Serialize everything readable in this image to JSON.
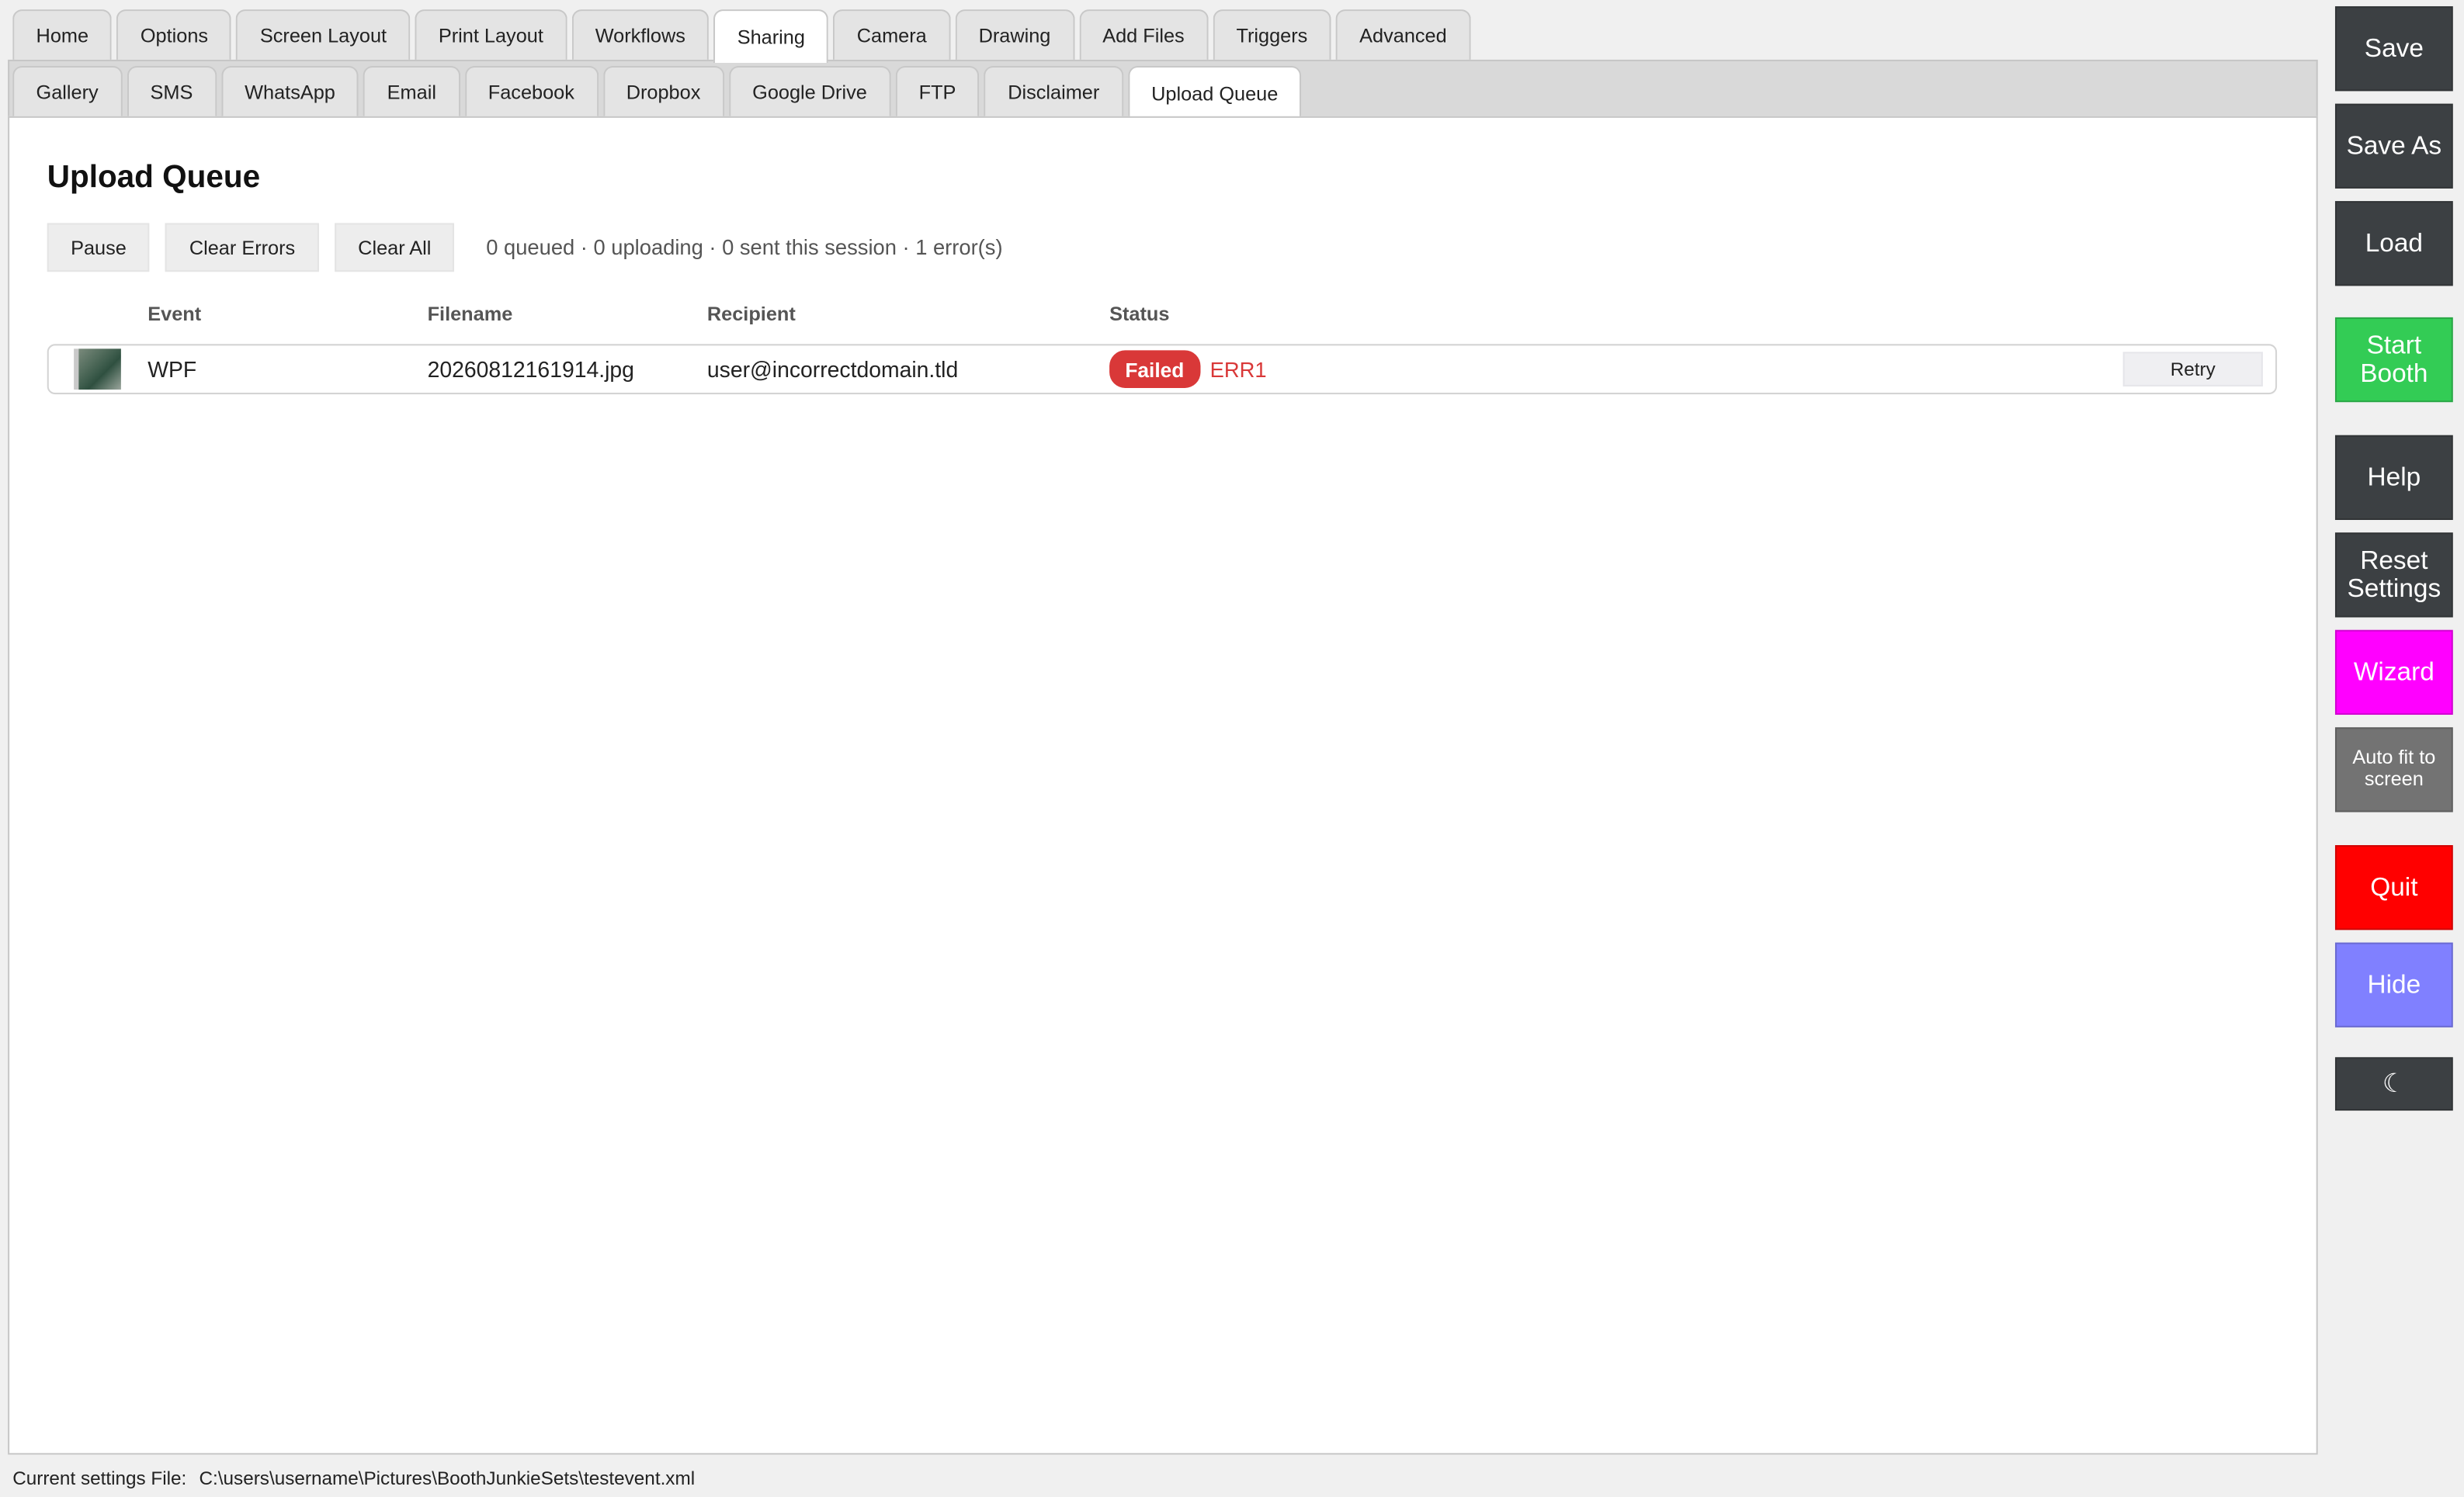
{
  "top_tabs": [
    {
      "label": "Home",
      "active": false
    },
    {
      "label": "Options",
      "active": false
    },
    {
      "label": "Screen Layout",
      "active": false
    },
    {
      "label": "Print Layout",
      "active": false
    },
    {
      "label": "Workflows",
      "active": false
    },
    {
      "label": "Sharing",
      "active": true
    },
    {
      "label": "Camera",
      "active": false
    },
    {
      "label": "Drawing",
      "active": false
    },
    {
      "label": "Add Files",
      "active": false
    },
    {
      "label": "Triggers",
      "active": false
    },
    {
      "label": "Advanced",
      "active": false
    }
  ],
  "sub_tabs": [
    {
      "label": "Gallery",
      "active": false
    },
    {
      "label": "SMS",
      "active": false
    },
    {
      "label": "WhatsApp",
      "active": false
    },
    {
      "label": "Email",
      "active": false
    },
    {
      "label": "Facebook",
      "active": false
    },
    {
      "label": "Dropbox",
      "active": false
    },
    {
      "label": "Google Drive",
      "active": false
    },
    {
      "label": "FTP",
      "active": false
    },
    {
      "label": "Disclaimer",
      "active": false
    },
    {
      "label": "Upload Queue",
      "active": true
    }
  ],
  "upload_queue": {
    "title": "Upload Queue",
    "pause_label": "Pause",
    "clear_errors_label": "Clear Errors",
    "clear_all_label": "Clear All",
    "summary": "0 queued · 0 uploading · 0 sent this session · 1 error(s)",
    "columns": {
      "event": "Event",
      "filename": "Filename",
      "recipient": "Recipient",
      "status": "Status"
    },
    "rows": [
      {
        "event": "WPF",
        "filename": "20260812161914.jpg",
        "recipient": "user@incorrectdomain.tld",
        "status": "Failed",
        "error_code": "ERR1",
        "action_label": "Retry"
      }
    ]
  },
  "status_bar": {
    "label": "Current settings File:",
    "path": "C:\\users\\username\\Pictures\\BoothJunkieSets\\testevent.xml"
  },
  "side_buttons": {
    "save": "Save",
    "save_as": "Save As",
    "load": "Load",
    "start_booth": "Start\nBooth",
    "help": "Help",
    "reset_settings": "Reset\nSettings",
    "wizard": "Wizard",
    "auto_fit": "Auto fit to\nscreen",
    "quit": "Quit",
    "hide": "Hide",
    "theme_toggle": "☾"
  },
  "colors": {
    "dark_button": "#3c4043",
    "start_booth": "#33cc55",
    "wizard": "#ff00ff",
    "auto_fit": "#737373",
    "quit": "#ff0000",
    "hide": "#8080ff",
    "failed_badge": "#d93838",
    "error_text": "#d93838"
  }
}
